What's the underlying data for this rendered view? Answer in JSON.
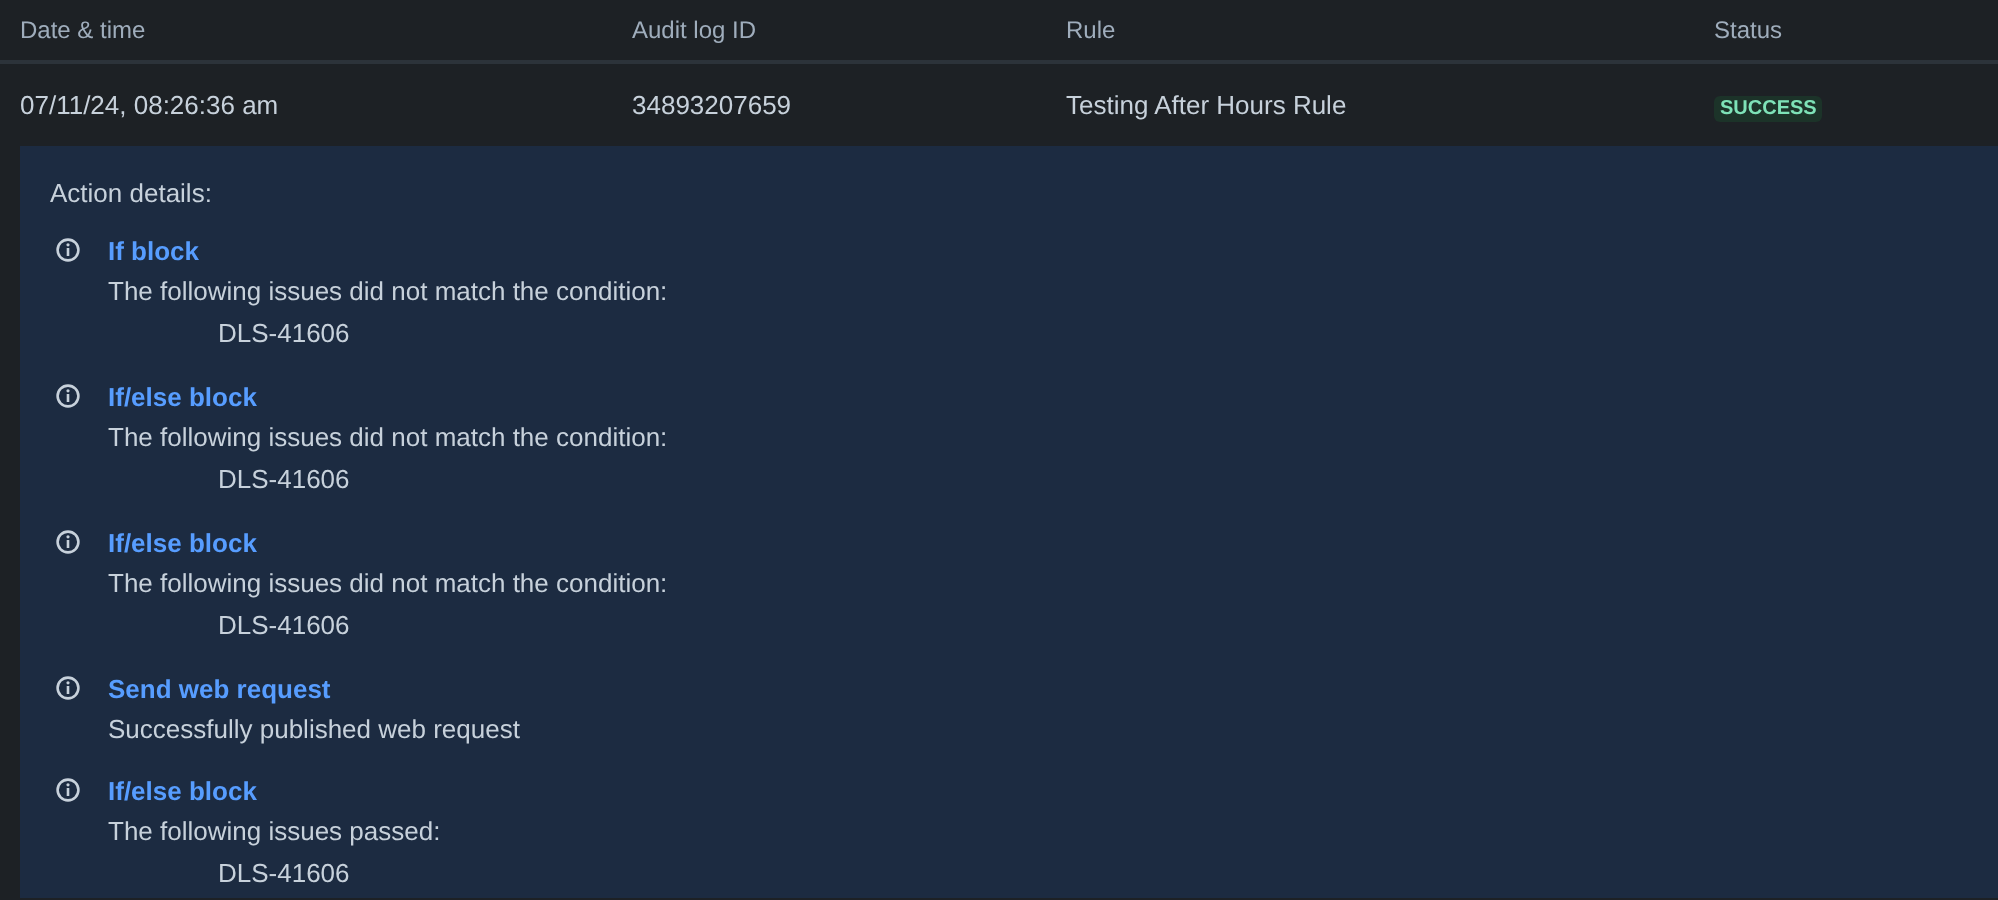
{
  "table": {
    "columns": [
      "Date & time",
      "Audit log ID",
      "Rule",
      "Status"
    ],
    "rows": [
      {
        "date_time": "07/11/24, 08:26:36 am",
        "audit_log_id": "34893207659",
        "rule": "Testing After Hours Rule",
        "status": {
          "label": "SUCCESS",
          "kind": "success"
        },
        "expanded": true,
        "details": {
          "heading": "Action details:",
          "actions": [
            {
              "title": "If block",
              "message": "The following issues did not match the condition:",
              "issues": [
                "DLS-41606"
              ]
            },
            {
              "title": "If/else block",
              "message": "The following issues did not match the condition:",
              "issues": [
                "DLS-41606"
              ]
            },
            {
              "title": "If/else block",
              "message": "The following issues did not match the condition:",
              "issues": [
                "DLS-41606"
              ]
            },
            {
              "title": "Send web request",
              "message": "Successfully published web request"
            },
            {
              "title": "If/else block",
              "message": "The following issues passed:",
              "issues": [
                "DLS-41606"
              ]
            }
          ]
        }
      }
    ]
  }
}
